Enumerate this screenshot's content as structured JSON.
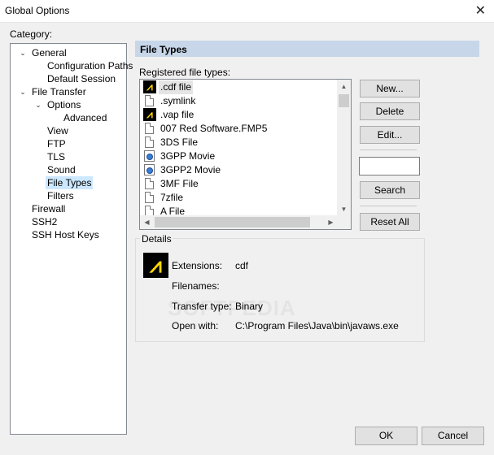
{
  "window": {
    "title": "Global Options",
    "close_glyph": "✕"
  },
  "category": {
    "label": "Category:",
    "tree": [
      {
        "label": "General",
        "toggle": "⌄"
      },
      {
        "label": "Configuration Paths"
      },
      {
        "label": "Default Session"
      },
      {
        "label": "File Transfer",
        "toggle": "⌄"
      },
      {
        "label": "Options",
        "toggle": "⌄"
      },
      {
        "label": "Advanced"
      },
      {
        "label": "View"
      },
      {
        "label": "FTP"
      },
      {
        "label": "TLS"
      },
      {
        "label": "Sound"
      },
      {
        "label": "File Types",
        "selected": true
      },
      {
        "label": "Filters"
      },
      {
        "label": "Firewall"
      },
      {
        "label": "SSH2"
      },
      {
        "label": "SSH Host Keys"
      }
    ]
  },
  "panel": {
    "title": "File Types",
    "registered_label": "Registered file types:",
    "files": [
      {
        "name": ".cdf file",
        "icon": "java-icon",
        "selected": true
      },
      {
        "name": ".symlink",
        "icon": "document-icon"
      },
      {
        "name": ".vap file",
        "icon": "java-icon"
      },
      {
        "name": "007 Red Software.FMP5",
        "icon": "document-icon"
      },
      {
        "name": "3DS File",
        "icon": "document-icon"
      },
      {
        "name": "3GPP Movie",
        "icon": "movie-icon"
      },
      {
        "name": "3GPP2 Movie",
        "icon": "movie-icon"
      },
      {
        "name": "3MF File",
        "icon": "document-icon"
      },
      {
        "name": "7zfile",
        "icon": "document-icon"
      },
      {
        "name": "A File",
        "icon": "document-icon"
      }
    ],
    "buttons": {
      "new": "New...",
      "delete": "Delete",
      "edit": "Edit...",
      "search": "Search",
      "reset_all": "Reset All"
    },
    "search_value": ""
  },
  "details": {
    "title": "Details",
    "extensions_label": "Extensions:",
    "extensions_value": "cdf",
    "filenames_label": "Filenames:",
    "filenames_value": "",
    "transfer_type_label": "Transfer type:",
    "transfer_type_value": "Binary",
    "open_with_label": "Open with:",
    "open_with_value": "C:\\Program Files\\Java\\bin\\javaws.exe",
    "watermark": "SOFTPEDIA"
  },
  "footer": {
    "ok": "OK",
    "cancel": "Cancel"
  },
  "colors": {
    "panel_header_bg": "#c7d6e8",
    "selection_bg": "#cce8ff",
    "java_icon_fg": "#ffd800"
  }
}
